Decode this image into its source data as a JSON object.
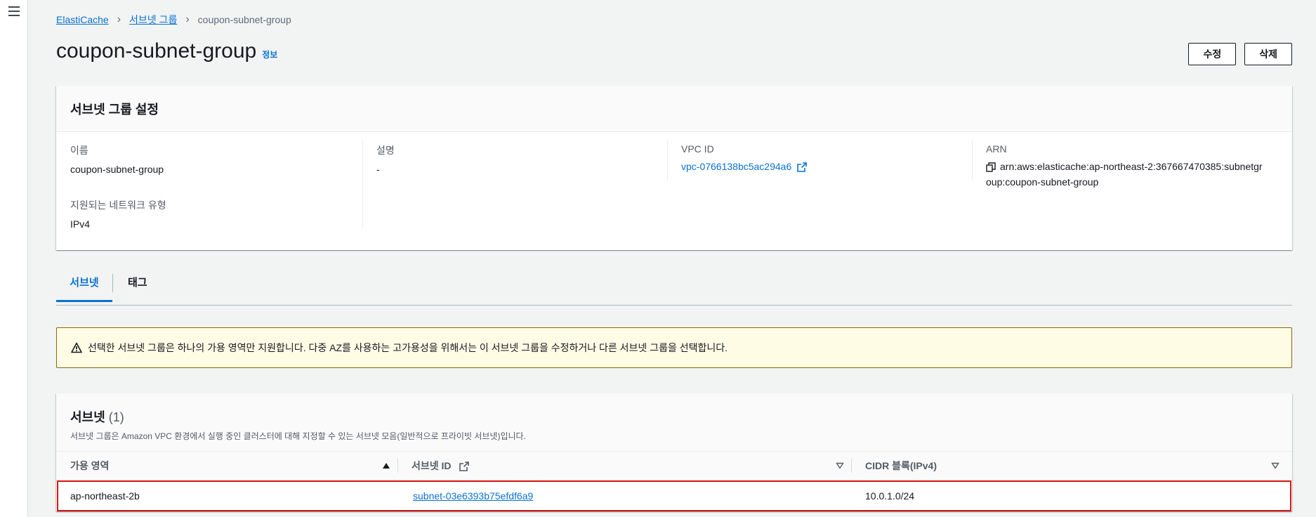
{
  "breadcrumb": {
    "items": [
      "ElastiCache",
      "서브넷 그룹"
    ],
    "current": "coupon-subnet-group"
  },
  "header": {
    "title": "coupon-subnet-group",
    "info_label": "정보",
    "edit_label": "수정",
    "delete_label": "삭제"
  },
  "settings": {
    "title": "서브넷 그룹 설정",
    "name_label": "이름",
    "name_value": "coupon-subnet-group",
    "description_label": "설명",
    "description_value": "-",
    "vpc_label": "VPC ID",
    "vpc_value": "vpc-0766138bc5ac294a6",
    "arn_label": "ARN",
    "arn_value": "arn:aws:elasticache:ap-northeast-2:367667470385:subnetgroup:coupon-subnet-group",
    "network_type_label": "지원되는 네트워크 유형",
    "network_type_value": "IPv4"
  },
  "tabs": [
    {
      "label": "서브넷",
      "active": true
    },
    {
      "label": "태그",
      "active": false
    }
  ],
  "alert": {
    "text": "선택한 서브넷 그룹은 하나의 가용 영역만 지원합니다. 다중 AZ를 사용하는 고가용성을 위해서는 이 서브넷 그룹을 수정하거나 다른 서브넷 그룹을 선택합니다."
  },
  "subnets": {
    "title": "서브넷",
    "count": "(1)",
    "description": "서브넷 그룹은 Amazon VPC 환경에서 실행 중인 클러스터에 대해 지정할 수 있는 서브넷 모음(일반적으로 프라이빗 서브넷)입니다.",
    "columns": [
      "가용 영역",
      "서브넷 ID",
      "CIDR 블록(IPv4)"
    ],
    "rows": [
      {
        "az": "ap-northeast-2b",
        "subnet_id": "subnet-03e6393b75efdf6a9",
        "cidr": "10.0.1.0/24"
      }
    ]
  },
  "colors": {
    "link": "#0972d3",
    "warning_border": "#8d6605",
    "warning_bg": "#fffce6",
    "highlight": "#d91515"
  }
}
